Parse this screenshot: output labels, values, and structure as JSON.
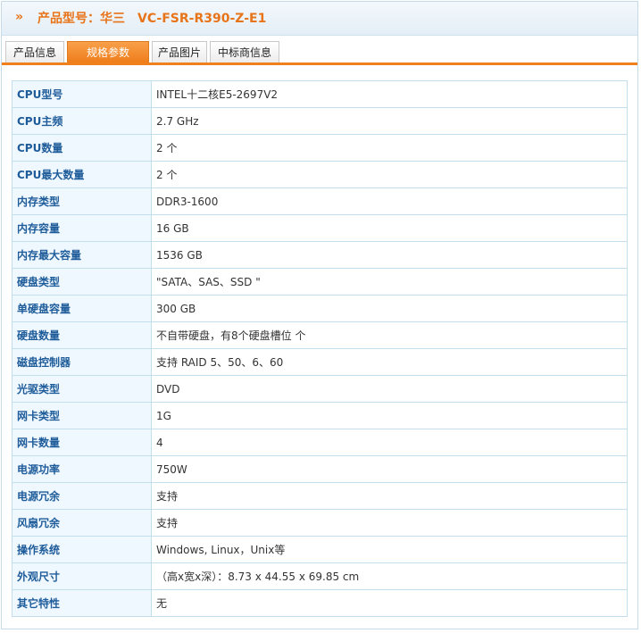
{
  "header": {
    "prefix": "产品型号：华三",
    "model": "VC-FSR-R390-Z-E1",
    "arrow_icon": "double-chevron-right-icon"
  },
  "tabs": [
    {
      "label": "产品信息",
      "active": false
    },
    {
      "label": "规格参数",
      "active": true
    },
    {
      "label": "产品图片",
      "active": false
    },
    {
      "label": "中标商信息",
      "active": false
    }
  ],
  "colors": {
    "accent": "#f0801c",
    "key_text": "#1e5c9a",
    "key_bg": "#f0f8ff",
    "border": "#c3dfee"
  },
  "specs": [
    {
      "key": "CPU型号",
      "value": "INTEL十二核E5-2697V2"
    },
    {
      "key": "CPU主频",
      "value": "2.7  GHz"
    },
    {
      "key": "CPU数量",
      "value": "2 个"
    },
    {
      "key": "CPU最大数量",
      "value": "2 个"
    },
    {
      "key": "内存类型",
      "value": "DDR3-1600"
    },
    {
      "key": "内存容量",
      "value": "16  GB"
    },
    {
      "key": "内存最大容量",
      "value": "1536  GB"
    },
    {
      "key": "硬盘类型",
      "value": "\"SATA、SAS、SSD \""
    },
    {
      "key": "单硬盘容量",
      "value": "300  GB"
    },
    {
      "key": "硬盘数量",
      "value": "不自带硬盘，有8个硬盘槽位  个"
    },
    {
      "key": "磁盘控制器",
      "value": "支持 RAID 5、50、6、60"
    },
    {
      "key": "光驱类型",
      "value": "DVD"
    },
    {
      "key": "网卡类型",
      "value": "1G"
    },
    {
      "key": "网卡数量",
      "value": "4"
    },
    {
      "key": "电源功率",
      "value": "750W"
    },
    {
      "key": "电源冗余",
      "value": "支持"
    },
    {
      "key": "风扇冗余",
      "value": "支持"
    },
    {
      "key": "操作系统",
      "value": "Windows, Linux，Unix等"
    },
    {
      "key": "外观尺寸",
      "value": "（高x宽x深）：8.73 x 44.55 x 69.85 cm"
    },
    {
      "key": "其它特性",
      "value": "无"
    }
  ]
}
